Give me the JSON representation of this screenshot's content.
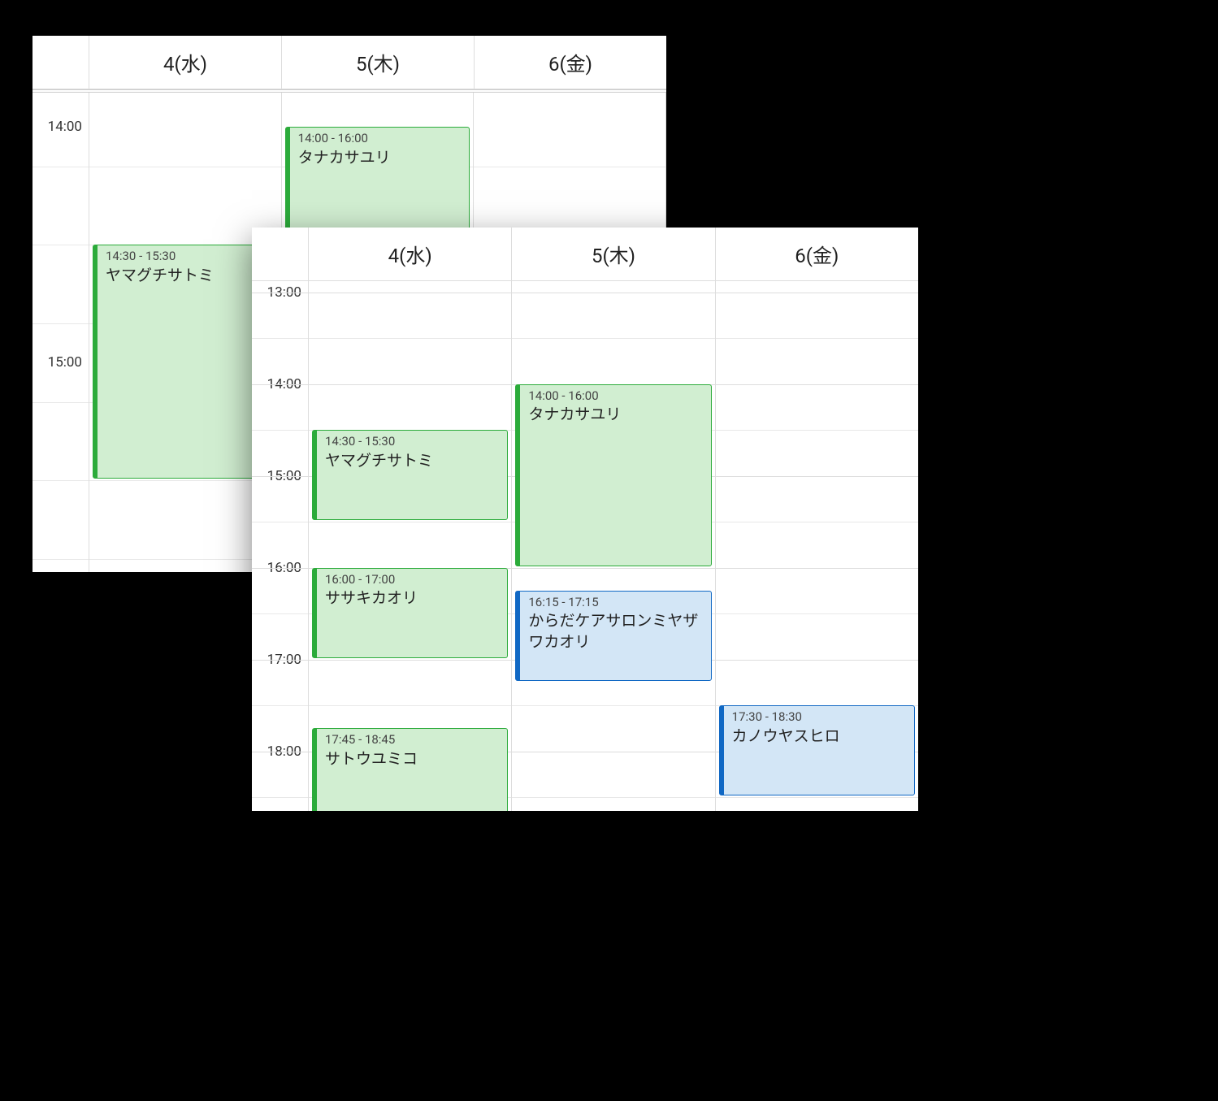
{
  "back": {
    "days": [
      {
        "label": "4(水)"
      },
      {
        "label": "5(木)"
      },
      {
        "label": "6(金)"
      }
    ],
    "hourHeightPx": 290,
    "topHour": 13.84,
    "timeLabels": [
      {
        "text": "14:00",
        "hour": 14
      },
      {
        "text": "15:00",
        "hour": 15
      }
    ],
    "events": [
      {
        "dayIndex": 0,
        "startHour": 14.5,
        "endHour": 15.5,
        "time": "14:30 - 15:30",
        "title": "ヤマグチサトミ",
        "style": "green-outline"
      },
      {
        "dayIndex": 1,
        "startHour": 14,
        "endHour": 16,
        "time": "14:00 - 16:00",
        "title": "タナカサユリ",
        "style": "green-outline"
      }
    ]
  },
  "front": {
    "days": [
      {
        "label": "4(水)"
      },
      {
        "label": "5(木)"
      },
      {
        "label": "6(金)"
      }
    ],
    "hourHeightPx": 113,
    "topHour": 12.88,
    "timeLabels": [
      {
        "text": "13:00",
        "hour": 13
      },
      {
        "text": "14:00",
        "hour": 14
      },
      {
        "text": "15:00",
        "hour": 15
      },
      {
        "text": "16:00",
        "hour": 16
      },
      {
        "text": "17:00",
        "hour": 17
      },
      {
        "text": "18:00",
        "hour": 18
      }
    ],
    "events": [
      {
        "dayIndex": 0,
        "startHour": 14.5,
        "endHour": 15.5,
        "time": "14:30 - 15:30",
        "title": "ヤマグチサトミ",
        "style": "green-outline"
      },
      {
        "dayIndex": 0,
        "startHour": 16,
        "endHour": 17,
        "time": "16:00 - 17:00",
        "title": "ササキカオリ",
        "style": "green-outline"
      },
      {
        "dayIndex": 0,
        "startHour": 17.75,
        "endHour": 18.75,
        "time": "17:45 - 18:45",
        "title": "サトウユミコ",
        "style": "green-outline"
      },
      {
        "dayIndex": 1,
        "startHour": 14,
        "endHour": 16,
        "time": "14:00 - 16:00",
        "title": "タナカサユリ",
        "style": "green-outline"
      },
      {
        "dayIndex": 1,
        "startHour": 16.25,
        "endHour": 17.25,
        "time": "16:15 - 17:15",
        "title": "からだケアサロンミヤザワカオリ",
        "style": "blue"
      },
      {
        "dayIndex": 2,
        "startHour": 17.5,
        "endHour": 18.5,
        "time": "17:30 - 18:30",
        "title": "カノウヤスヒロ",
        "style": "blue"
      }
    ]
  }
}
